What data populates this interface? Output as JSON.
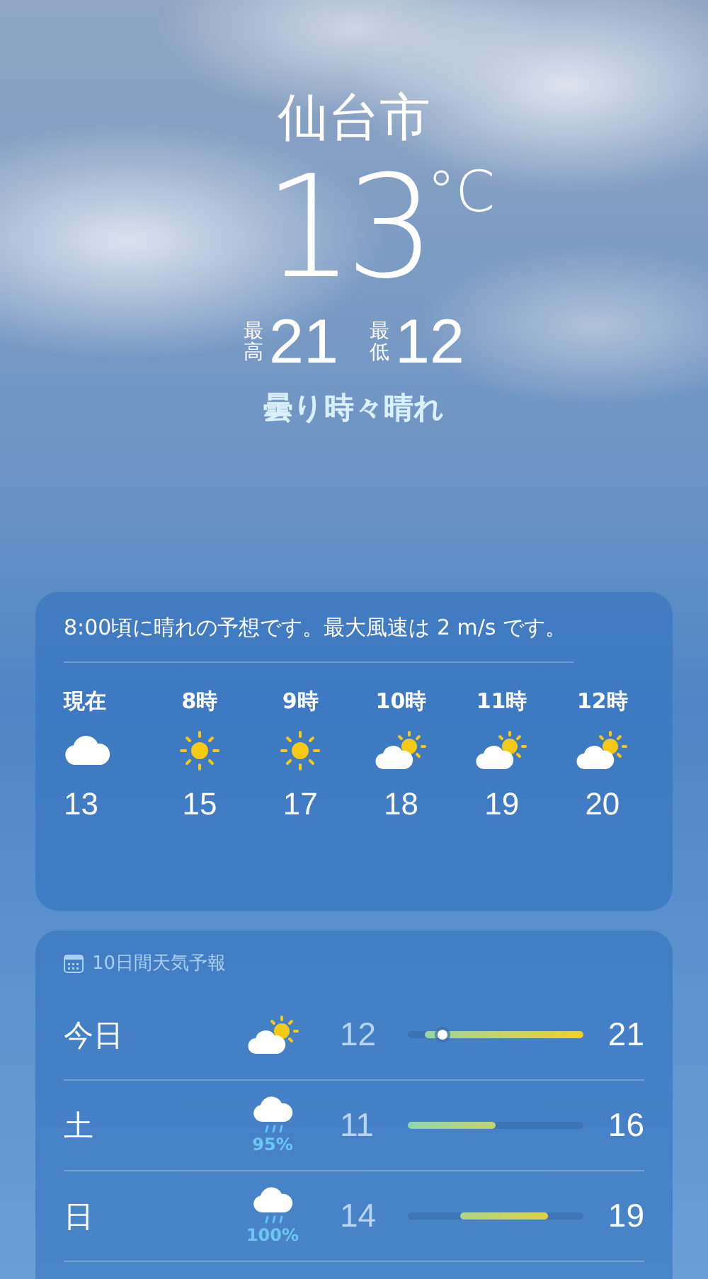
{
  "location": {
    "city": "仙台市",
    "temperature": "13",
    "unit": "°C",
    "high_label": "最高",
    "high": "21",
    "low_label": "最低",
    "low": "12",
    "condition": "曇り時々晴れ"
  },
  "hourly": {
    "summary": "8:00頃に晴れの予想です。最大風速は 2 m/s です。",
    "hours": [
      {
        "time": "現在",
        "kind": "cloud",
        "temp": "13"
      },
      {
        "time": "8時",
        "kind": "sun",
        "temp": "15"
      },
      {
        "time": "9時",
        "kind": "sun",
        "temp": "17"
      },
      {
        "time": "10時",
        "kind": "partlycloudy",
        "temp": "18"
      },
      {
        "time": "11時",
        "kind": "partlycloudy",
        "temp": "19"
      },
      {
        "time": "12時",
        "kind": "partlycloudy",
        "temp": "20"
      }
    ]
  },
  "daily": {
    "title": "10日間天気予報",
    "days": [
      {
        "day": "今日",
        "kind": "partlycloudy",
        "low": "12",
        "high": "21",
        "current_marker": true
      },
      {
        "day": "土",
        "kind": "rain",
        "precipitation": "95%",
        "low": "11",
        "high": "16",
        "current_marker": false
      },
      {
        "day": "日",
        "kind": "rain",
        "precipitation": "100%",
        "low": "14",
        "high": "19",
        "current_marker": false
      }
    ]
  }
}
